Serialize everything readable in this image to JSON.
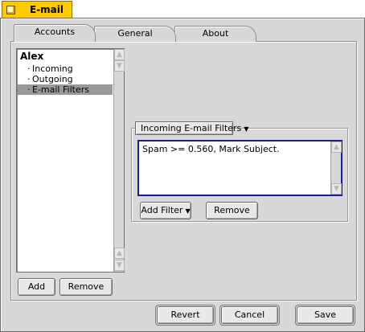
{
  "window": {
    "title": "E-mail"
  },
  "tabs": [
    {
      "label": "Accounts",
      "selected": true
    },
    {
      "label": "General",
      "selected": false
    },
    {
      "label": "About",
      "selected": false
    }
  ],
  "accounts_list": {
    "account_name": "Alex",
    "items": [
      {
        "label": "Incoming",
        "selected": false
      },
      {
        "label": "Outgoing",
        "selected": false
      },
      {
        "label": "E-mail Filters",
        "selected": true
      }
    ],
    "bullet": "·"
  },
  "list_buttons": {
    "add": "Add",
    "remove": "Remove"
  },
  "filters": {
    "menu_label": "Incoming E-mail Filters",
    "entries": [
      "Spam >= 0.560, Mark Subject."
    ],
    "add_filter": "Add Filter",
    "remove": "Remove"
  },
  "footer": {
    "revert": "Revert",
    "cancel": "Cancel",
    "save": "Save"
  },
  "colors": {
    "title_tab": "#ffcb00",
    "panel_bg": "#d8d8d8",
    "selection": "#999999",
    "focus_border": "#1a1aa0"
  },
  "icons": {
    "zoom": "zoom-box-icon",
    "scroll_up": "scroll-up-arrow-icon",
    "scroll_down": "scroll-down-arrow-icon",
    "popup": "popup-arrow-icon"
  }
}
